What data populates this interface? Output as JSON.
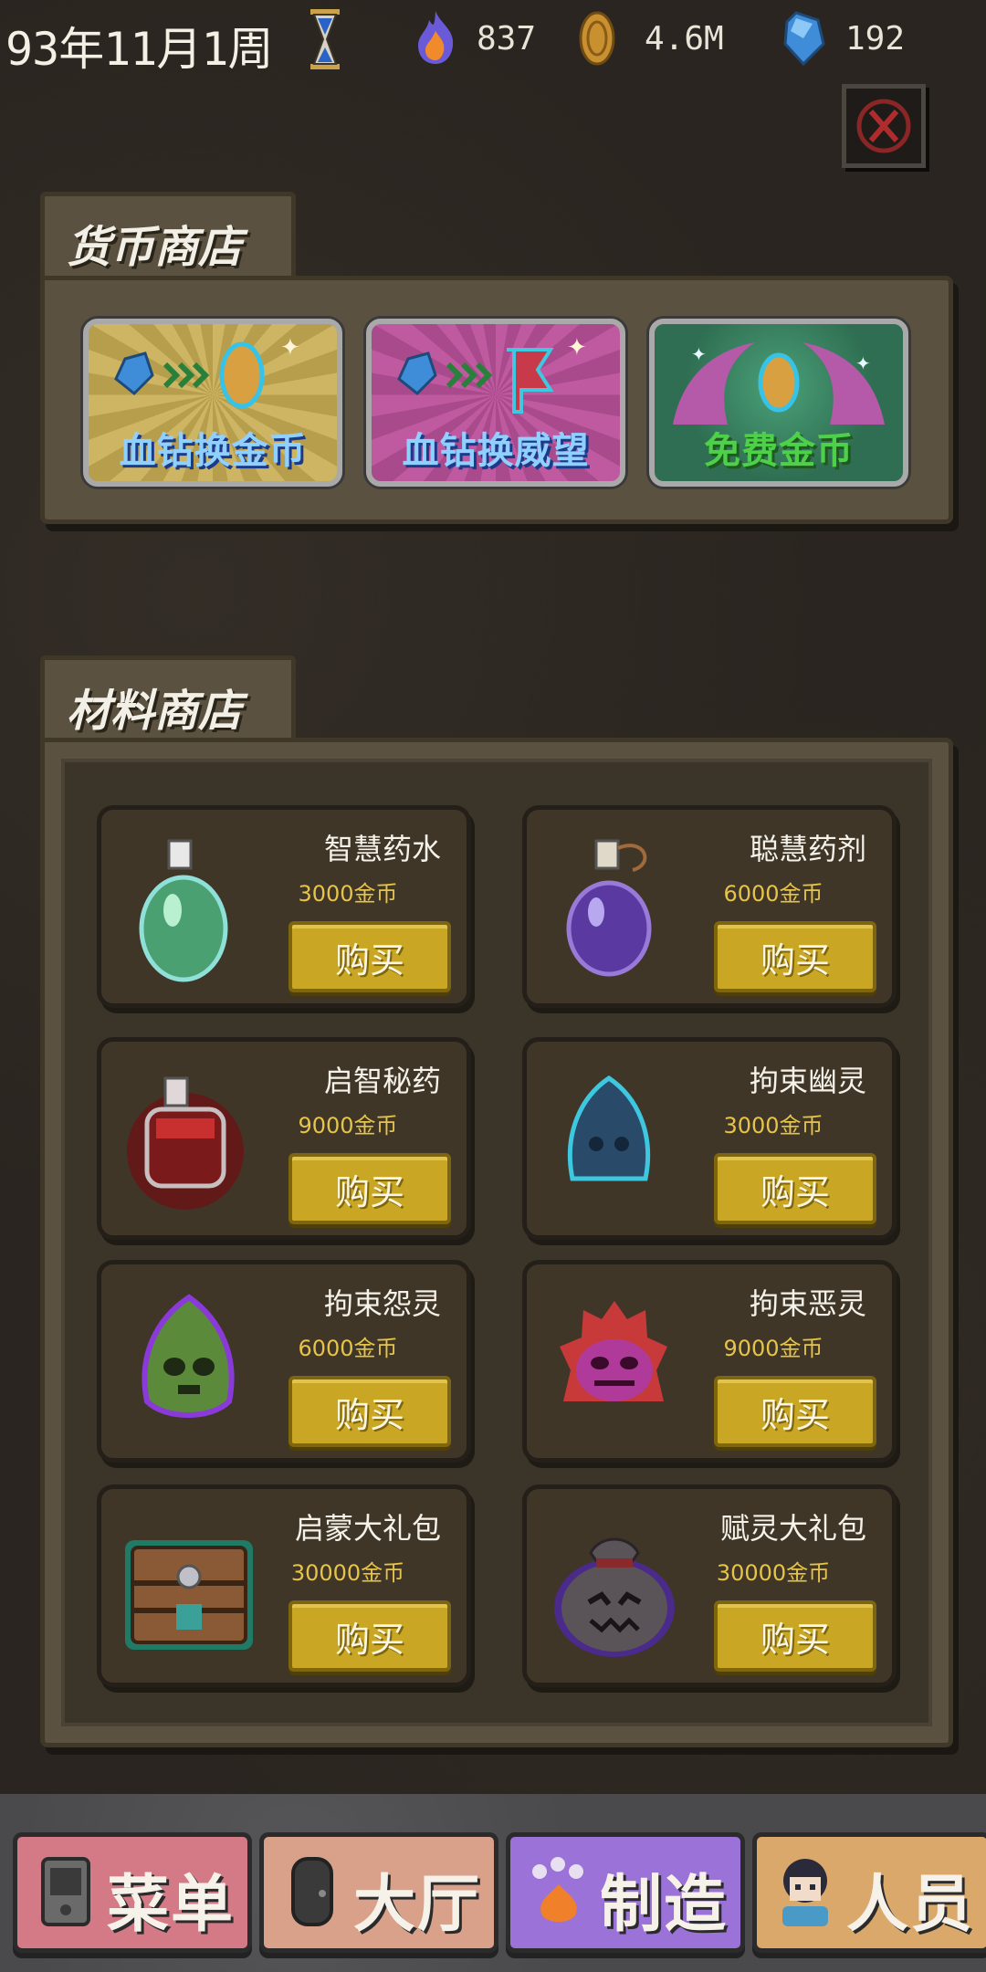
{
  "status": {
    "date": "93年11月1周",
    "fire": "837",
    "gold": "4.6M",
    "diamond": "192"
  },
  "currency_shop": {
    "title": "货币商店",
    "items": [
      {
        "label": "血钻换金币",
        "color": "#7ec8ff"
      },
      {
        "label": "血钻换威望",
        "color": "#7ec8ff"
      },
      {
        "label": "免费金币",
        "color": "#4fd04a"
      }
    ]
  },
  "material_shop": {
    "title": "材料商店",
    "buy_label": "购买",
    "items": [
      {
        "name": "智慧药水",
        "price": "3000金币",
        "icon": "green-potion-icon"
      },
      {
        "name": "聪慧药剂",
        "price": "6000金币",
        "icon": "purple-potion-icon"
      },
      {
        "name": "启智秘药",
        "price": "9000金币",
        "icon": "red-potion-icon"
      },
      {
        "name": "拘束幽灵",
        "price": "3000金币",
        "icon": "blue-ghost-icon"
      },
      {
        "name": "拘束怨灵",
        "price": "6000金币",
        "icon": "green-skull-ghost-icon"
      },
      {
        "name": "拘束恶灵",
        "price": "9000金币",
        "icon": "red-demon-ghost-icon"
      },
      {
        "name": "启蒙大礼包",
        "price": "30000金币",
        "icon": "treasure-chest-icon"
      },
      {
        "name": "赋灵大礼包",
        "price": "30000金币",
        "icon": "spirit-sack-icon"
      }
    ]
  },
  "nav": {
    "items": [
      {
        "label": "菜单",
        "icon": "phone-icon"
      },
      {
        "label": "大厅",
        "icon": "door-icon"
      },
      {
        "label": "制造",
        "icon": "paw-fire-icon"
      },
      {
        "label": "人员",
        "icon": "person-icon"
      }
    ]
  },
  "colors": {
    "buy_button": "#c9a724",
    "price_text": "#e6c44a",
    "panel": "#5a5140"
  }
}
